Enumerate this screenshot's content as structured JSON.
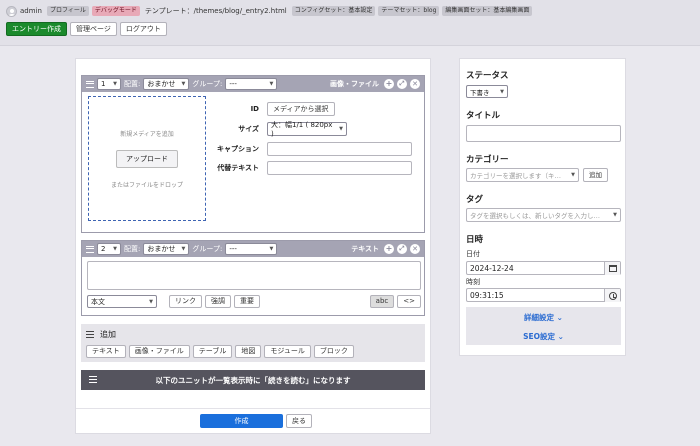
{
  "topbar": {
    "username": "admin",
    "profile": "プロフィール",
    "debug": "デバッグモード",
    "template": "テンプレート：/themes/blog/_entry2.html",
    "config_set": "コンフィグセット：基本設定",
    "theme_set": "テーマセット：blog",
    "editor_set": "編集画面セット：基本編集画面",
    "new_entry": "エントリー作成",
    "admin_page": "管理ページ",
    "logout": "ログアウト"
  },
  "units": [
    {
      "order": "1",
      "align_label": "配置:",
      "align_value": "おまかせ",
      "group_label": "グループ:",
      "group_value": "---",
      "title": "画像・ファイル",
      "dropzone": {
        "hint": "新規メディアを追加",
        "upload": "アップロード",
        "drop": "またはファイルをドロップ"
      },
      "fields": {
        "id_label": "ID",
        "id_button": "メディアから選択",
        "size_label": "サイズ",
        "size_value": "大：幅1/1 ( 820px )",
        "caption_label": "キャプション",
        "alt_label": "代替テキスト"
      }
    },
    {
      "order": "2",
      "align_label": "配置:",
      "align_value": "おまかせ",
      "group_label": "グループ:",
      "group_value": "---",
      "title": "テキスト",
      "format": "本文",
      "link": "リンク",
      "strong": "強調",
      "important": "重要",
      "abc": "abc",
      "code": "<>"
    }
  ],
  "add_unit": {
    "title": "追加",
    "buttons": [
      "テキスト",
      "画像・ファイル",
      "テーブル",
      "地図",
      "モジュール",
      "ブロック"
    ]
  },
  "notice": "以下のユニットが一覧表示時に「続きを読む」になります",
  "footer": {
    "create": "作成",
    "back": "戻る"
  },
  "sidebar": {
    "status_title": "ステータス",
    "status_value": "下書き",
    "title_title": "タイトル",
    "category_title": "カテゴリー",
    "category_placeholder": "カテゴリーを選択します（キ…",
    "category_add": "追加",
    "tag_title": "タグ",
    "tag_placeholder": "タグを選択もしくは、新しいタグを入力し…",
    "datetime_title": "日時",
    "date_label": "日付",
    "date_value": "2024-12-24",
    "time_label": "時刻",
    "time_value": "09:31:15",
    "advanced": "詳細設定",
    "seo": "SEO設定"
  },
  "colors": {
    "unit_header": "#a5a4b4",
    "primary": "#1a6fdc",
    "green": "#1b8a2c",
    "debug_badge": "#e8a9b7",
    "notice_bg": "#55545e"
  },
  "icons": [
    "user-icon",
    "menu-icon",
    "plus-circle-icon",
    "expand-icon",
    "close-circle-icon",
    "calendar-icon",
    "clock-icon",
    "chevron-down-icon"
  ]
}
